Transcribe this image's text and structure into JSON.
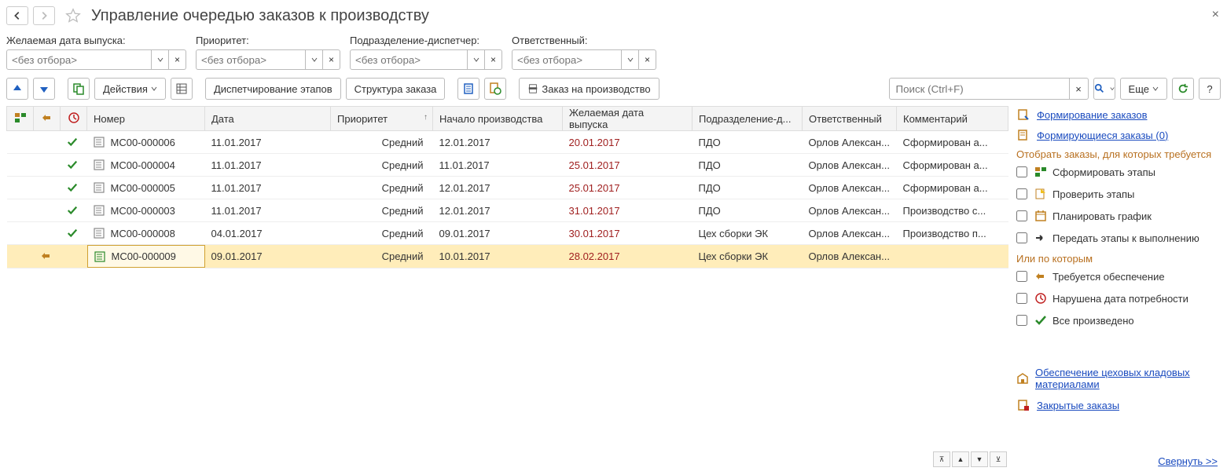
{
  "title": "Управление очередью заказов к производству",
  "filters": {
    "release_date": {
      "label": "Желаемая дата выпуска:",
      "placeholder": "<без отбора>"
    },
    "priority": {
      "label": "Приоритет:",
      "placeholder": "<без отбора>"
    },
    "department": {
      "label": "Подразделение-диспетчер:",
      "placeholder": "<без отбора>"
    },
    "responsible": {
      "label": "Ответственный:",
      "placeholder": "<без отбора>"
    }
  },
  "toolbar": {
    "actions": "Действия",
    "dispatch": "Диспетчирование этапов",
    "structure": "Структура заказа",
    "order_prod": "Заказ на производство",
    "search_placeholder": "Поиск (Ctrl+F)",
    "more": "Еще"
  },
  "columns": {
    "number": "Номер",
    "date": "Дата",
    "priority": "Приоритет",
    "start": "Начало производства",
    "desired": "Желаемая дата выпуска",
    "dept": "Подразделение-д...",
    "resp": "Ответственный",
    "comment": "Комментарий"
  },
  "rows": [
    {
      "status": "check",
      "num": "МС00-000006",
      "date": "11.01.2017",
      "priority": "Средний",
      "start": "12.01.2017",
      "desired": "20.01.2017",
      "dept": "ПДО",
      "resp": "Орлов Алексан...",
      "comment": "Сформирован а..."
    },
    {
      "status": "check",
      "num": "МС00-000004",
      "date": "11.01.2017",
      "priority": "Средний",
      "start": "11.01.2017",
      "desired": "25.01.2017",
      "dept": "ПДО",
      "resp": "Орлов Алексан...",
      "comment": "Сформирован а..."
    },
    {
      "status": "check",
      "num": "МС00-000005",
      "date": "11.01.2017",
      "priority": "Средний",
      "start": "12.01.2017",
      "desired": "25.01.2017",
      "dept": "ПДО",
      "resp": "Орлов Алексан...",
      "comment": "Сформирован а..."
    },
    {
      "status": "check",
      "num": "МС00-000003",
      "date": "11.01.2017",
      "priority": "Средний",
      "start": "12.01.2017",
      "desired": "31.01.2017",
      "dept": "ПДО",
      "resp": "Орлов Алексан...",
      "comment": "Производство с..."
    },
    {
      "status": "check",
      "num": "МС00-000008",
      "date": "04.01.2017",
      "priority": "Средний",
      "start": "09.01.2017",
      "desired": "30.01.2017",
      "dept": "Цех сборки ЭК",
      "resp": "Орлов Алексан...",
      "comment": "Производство п..."
    },
    {
      "status": "",
      "num": "МС00-000009",
      "date": "09.01.2017",
      "priority": "Средний",
      "start": "10.01.2017",
      "desired": "28.02.2017",
      "dept": "Цех сборки ЭК",
      "resp": "Орлов Алексан...",
      "comment": "",
      "selected": true,
      "supply": true
    }
  ],
  "sidebar": {
    "link1": "Формирование заказов",
    "link2": "Формирующиеся заказы (0)",
    "heading1": "Отобрать заказы, для которых требуется",
    "chk_form": "Сформировать этапы",
    "chk_check": "Проверить этапы",
    "chk_plan": "Планировать график",
    "chk_pass": "Передать этапы к выполнению",
    "heading2": "Или по которым",
    "chk_supply": "Требуется обеспечение",
    "chk_violated": "Нарушена дата потребности",
    "chk_done": "Все произведено",
    "link3": "Обеспечение цеховых кладовых материалами",
    "link4": "Закрытые заказы",
    "collapse": "Свернуть >>"
  }
}
